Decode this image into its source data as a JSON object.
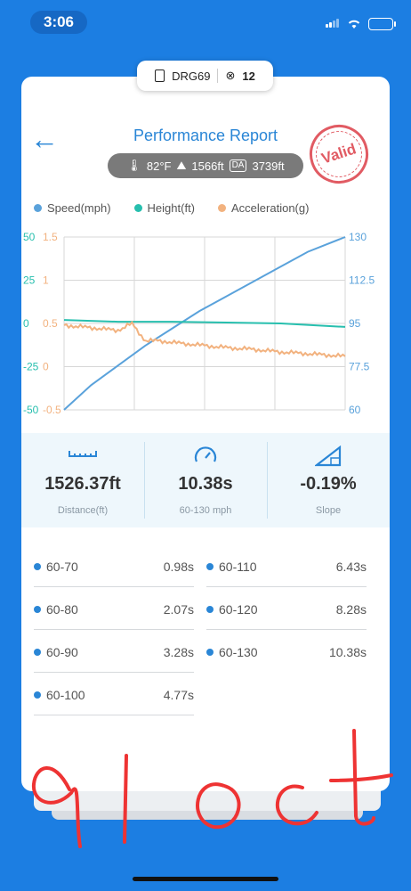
{
  "status": {
    "time": "3:06"
  },
  "device": {
    "name": "DRG69",
    "satellites": "12"
  },
  "header": {
    "title": "Performance Report",
    "stamp": "Valid"
  },
  "conditions": {
    "temp": "82°F",
    "altitude": "1566ft",
    "da_label": "DA",
    "density_altitude": "3739ft"
  },
  "legend": [
    {
      "label": "Speed(mph)",
      "color": "#5aa2db"
    },
    {
      "label": "Height(ft)",
      "color": "#27bfae"
    },
    {
      "label": "Acceleration(g)",
      "color": "#f2b27f"
    }
  ],
  "chart_data": {
    "type": "line",
    "y_axes": {
      "height_ticks": [
        "50",
        "25",
        "0",
        "-25",
        "-50"
      ],
      "accel_ticks": [
        "1.5",
        "1",
        "0.5",
        "0",
        "-0.5"
      ],
      "speed_ticks": [
        "130",
        "112.5",
        "95",
        "77.5",
        "60"
      ]
    },
    "series": [
      {
        "name": "Speed(mph)",
        "color": "#5aa2db",
        "x": [
          0,
          1,
          2,
          3,
          4,
          5,
          6,
          7,
          8,
          9,
          10.38
        ],
        "y": [
          60,
          70,
          78,
          86,
          93,
          100,
          106,
          112,
          118,
          124,
          130
        ],
        "ylim": [
          60,
          130
        ]
      },
      {
        "name": "Height(ft)",
        "color": "#27bfae",
        "x": [
          0,
          2,
          4,
          6,
          8,
          10.38
        ],
        "y": [
          2,
          1,
          1,
          0.5,
          0,
          -2
        ],
        "ylim": [
          -50,
          50
        ]
      },
      {
        "name": "Acceleration(g)",
        "color": "#f2b27f",
        "x": [
          0,
          1,
          2,
          2.5,
          3,
          3.5,
          4,
          5,
          6,
          7,
          8,
          9,
          10.38
        ],
        "y": [
          0.48,
          0.45,
          0.42,
          0.5,
          0.3,
          0.3,
          0.28,
          0.25,
          0.22,
          0.2,
          0.17,
          0.15,
          0.12
        ],
        "ylim": [
          -0.5,
          1.5
        ]
      }
    ],
    "grid": true
  },
  "stats": [
    {
      "value": "1526.37ft",
      "label": "Distance(ft)",
      "icon": "ruler-icon"
    },
    {
      "value": "10.38s",
      "label": "60-130 mph",
      "icon": "speedometer-icon"
    },
    {
      "value": "-0.19%",
      "label": "Slope",
      "icon": "slope-icon"
    }
  ],
  "splits": [
    {
      "range": "60-70",
      "time": "0.98s"
    },
    {
      "range": "60-80",
      "time": "2.07s"
    },
    {
      "range": "60-90",
      "time": "3.28s"
    },
    {
      "range": "60-100",
      "time": "4.77s"
    },
    {
      "range": "60-110",
      "time": "6.43s"
    },
    {
      "range": "60-120",
      "time": "8.28s"
    },
    {
      "range": "60-130",
      "time": "10.38s"
    }
  ]
}
